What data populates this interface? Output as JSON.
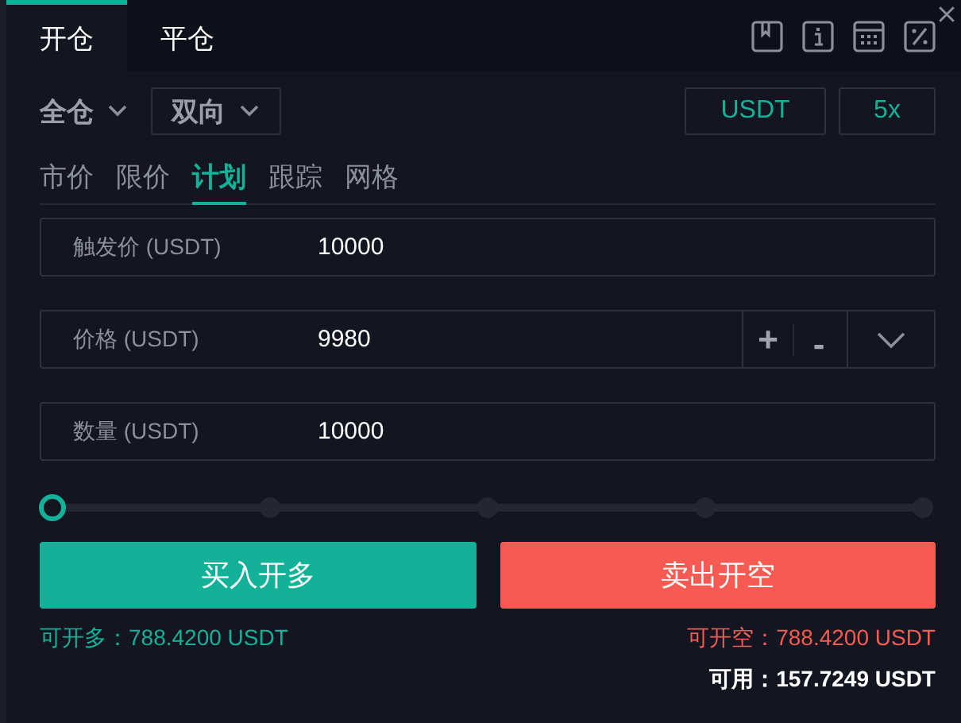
{
  "top_tabs": [
    {
      "label": "开仓",
      "selected": true
    },
    {
      "label": "平仓",
      "selected": false
    }
  ],
  "mode": {
    "margin": "全仓",
    "position": "双向",
    "currency": "USDT",
    "leverage": "5x"
  },
  "order_tabs": [
    {
      "label": "市价",
      "selected": false
    },
    {
      "label": "限价",
      "selected": false
    },
    {
      "label": "计划",
      "selected": true
    },
    {
      "label": "跟踪",
      "selected": false
    },
    {
      "label": "网格",
      "selected": false
    }
  ],
  "fields": [
    {
      "kind": "plain",
      "label": "触发价 (USDT)",
      "value": "10000"
    },
    {
      "kind": "stepper",
      "label": "价格 (USDT)",
      "value": "9980",
      "plus": "+",
      "minus": "-"
    },
    {
      "kind": "plain",
      "label": "数量 (USDT)",
      "value": "10000"
    }
  ],
  "slider": {
    "level": 0
  },
  "buttons": [
    {
      "kind": "buy",
      "label": "买入开多"
    },
    {
      "kind": "sell",
      "label": "卖出开空"
    }
  ],
  "can_long": "可开多：788.4200 USDT",
  "can_short": "可开空：788.4200 USDT",
  "available": "可用：157.7249 USDT"
}
